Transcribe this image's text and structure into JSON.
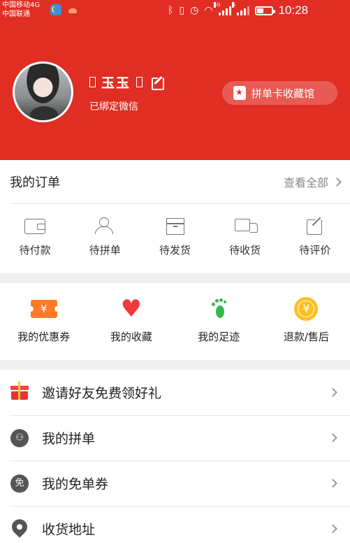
{
  "status_bar": {
    "carrier1": "中国移动4G",
    "carrier2": "中国联通",
    "time": "10:28",
    "net1": "4G",
    "net2": "G",
    "icons": [
      "moon-app-icon",
      "cloud-app-icon",
      "bluetooth-icon",
      "vibrate-icon",
      "alarm-icon",
      "wifi-icon",
      "signal-icon",
      "battery-icon"
    ]
  },
  "profile": {
    "name": "玉玉",
    "bound_text": "已绑定微信",
    "card_button": "拼单卡收藏馆"
  },
  "orders": {
    "title": "我的订单",
    "see_all": "查看全部",
    "items": [
      {
        "label": "待付款",
        "icon": "wallet-icon"
      },
      {
        "label": "待拼单",
        "icon": "group-icon"
      },
      {
        "label": "待发货",
        "icon": "box-icon"
      },
      {
        "label": "待收货",
        "icon": "truck-icon"
      },
      {
        "label": "待评价",
        "icon": "edit-icon"
      }
    ]
  },
  "shortcuts": [
    {
      "label": "我的优惠券",
      "icon": "coupon-icon",
      "glyph": "¥"
    },
    {
      "label": "我的收藏",
      "icon": "heart-icon",
      "glyph": "♥"
    },
    {
      "label": "我的足迹",
      "icon": "footprint-icon"
    },
    {
      "label": "退款/售后",
      "icon": "refund-icon",
      "glyph": "¥"
    }
  ],
  "menu": [
    {
      "label": "邀请好友免费领好礼",
      "icon": "gift-icon"
    },
    {
      "label": "我的拼单",
      "icon": "group-circle-icon"
    },
    {
      "label": "我的免单券",
      "icon": "free-order-icon",
      "glyph": "免"
    },
    {
      "label": "收货地址",
      "icon": "location-pin-icon"
    }
  ],
  "colors": {
    "brand_red": "#e02e24",
    "coupon_orange": "#ff7a29",
    "heart_red": "#ef3b3b",
    "foot_green": "#35b84a",
    "refund_yellow": "#ffbf1f"
  }
}
